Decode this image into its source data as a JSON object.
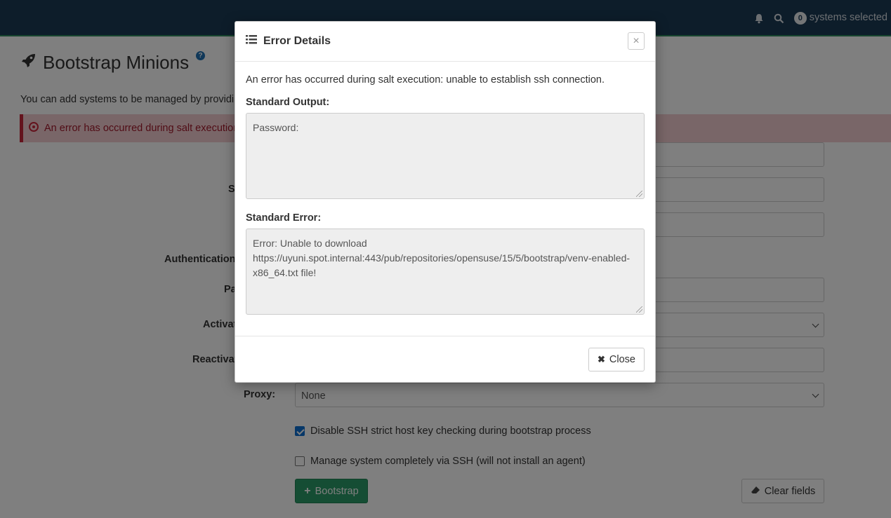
{
  "topbar": {
    "systems_count": "0",
    "systems_label": "systems selected",
    "icons": [
      "bell-icon",
      "search-icon"
    ]
  },
  "page": {
    "title": "Bootstrap Minions",
    "help_label": "?",
    "intro": "You can add systems to be managed by providing",
    "alert_text": "An error has occurred during salt execution:",
    "labels": {
      "ssh_port_partial": "S",
      "authentication": "Authentication",
      "password_partial": "Pa",
      "activation_partial": "Activat",
      "reactivation_partial": "Reactivat",
      "proxy": "Proxy:"
    },
    "proxy_value": "None",
    "disable_ssh_check_label": "Disable SSH strict host key checking during bootstrap process",
    "disable_ssh_check_checked": true,
    "manage_ssh_label": "Manage system completely via SSH (will not install an agent)",
    "manage_ssh_checked": false,
    "bootstrap_button": "Bootstrap",
    "clear_button": "Clear fields"
  },
  "modal": {
    "title": "Error Details",
    "close_x": "×",
    "message": "An error has occurred during salt execution: unable to establish ssh connection.",
    "stdout_label": "Standard Output:",
    "stdout_value": "Password:",
    "stderr_label": "Standard Error:",
    "stderr_value": "Error: Unable to download https://uyuni.spot.internal:443/pub/repositories/opensuse/15/5/bootstrap/venv-enabled-x86_64.txt file!",
    "close_button": "Close"
  },
  "colors": {
    "topbar": "#1b3a55",
    "accent_green": "#2a9b68",
    "alert_bg": "#f3cdd1",
    "alert_border": "#c8263a",
    "checkbox_blue": "#0d6fd1"
  }
}
